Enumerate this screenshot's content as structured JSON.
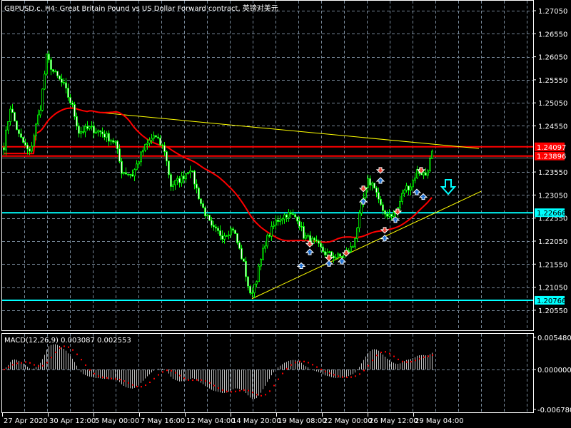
{
  "header": {
    "title": "GBPUSD.c, H4:  Great Britain Pound vs US Dollar Forward contract, 英镑对美元"
  },
  "macd": {
    "label": "MACD(12,26,9) 0.003087 0.002553",
    "axis": [
      "0.005480",
      "0.000000",
      "-0.006780"
    ],
    "max": 0.00548,
    "min": -0.00678
  },
  "price_axis": [
    "1.27050",
    "1.26550",
    "1.26050",
    "1.25550",
    "1.25050",
    "1.24550",
    "1.23550",
    "1.23050",
    "1.22550",
    "1.22050",
    "1.21550",
    "1.21050",
    "1.20550"
  ],
  "time_axis": [
    "27 Apr 2020",
    "30 Apr 12:00",
    "5 May 00:00",
    "7 May 16:00",
    "12 May 04:00",
    "14 May 20:00",
    "19 May 08:00",
    "22 May 00:00",
    "26 May 12:00",
    "29 May 04:00"
  ],
  "levels": [
    {
      "price": "1.24097",
      "color": "#ff0000"
    },
    {
      "price": "1.23896",
      "color": "#ff0000"
    },
    {
      "price": "1.22666",
      "color": "#00ffff"
    },
    {
      "price": "1.20766",
      "color": "#00ffff"
    }
  ],
  "colors": {
    "candle": "#00ff00",
    "ma": "#ff0000",
    "trend": "#ffff00",
    "grid": "#778899",
    "signal": "#ff0000",
    "hist": "#c0c0c0"
  },
  "chart_data": {
    "type": "candlestick",
    "symbol": "GBPUSD.c",
    "timeframe": "H4",
    "bars": 201,
    "close_anchors": [
      [
        0,
        1.2411
      ],
      [
        3,
        1.2496
      ],
      [
        7,
        1.2434
      ],
      [
        12,
        1.2395
      ],
      [
        17,
        1.2496
      ],
      [
        20,
        1.2604
      ],
      [
        23,
        1.2573
      ],
      [
        28,
        1.2542
      ],
      [
        32,
        1.2496
      ],
      [
        35,
        1.2442
      ],
      [
        40,
        1.245
      ],
      [
        45,
        1.2442
      ],
      [
        52,
        1.2419
      ],
      [
        55,
        1.2357
      ],
      [
        60,
        1.2349
      ],
      [
        65,
        1.2403
      ],
      [
        70,
        1.2434
      ],
      [
        75,
        1.2403
      ],
      [
        78,
        1.2326
      ],
      [
        83,
        1.2341
      ],
      [
        87,
        1.2364
      ],
      [
        92,
        1.2287
      ],
      [
        97,
        1.2233
      ],
      [
        102,
        1.2217
      ],
      [
        107,
        1.2233
      ],
      [
        112,
        1.2155
      ],
      [
        115,
        1.2086
      ],
      [
        118,
        1.2125
      ],
      [
        122,
        1.2202
      ],
      [
        127,
        1.2248
      ],
      [
        132,
        1.2264
      ],
      [
        137,
        1.2256
      ],
      [
        140,
        1.2217
      ],
      [
        145,
        1.2202
      ],
      [
        150,
        1.2179
      ],
      [
        155,
        1.2171
      ],
      [
        158,
        1.2171
      ],
      [
        163,
        1.2194
      ],
      [
        167,
        1.2279
      ],
      [
        170,
        1.2334
      ],
      [
        173,
        1.2326
      ],
      [
        177,
        1.2264
      ],
      [
        180,
        1.2264
      ],
      [
        183,
        1.2264
      ],
      [
        187,
        1.2318
      ],
      [
        190,
        1.2326
      ],
      [
        193,
        1.2357
      ],
      [
        197,
        1.2349
      ],
      [
        200,
        1.2395
      ]
    ],
    "ma_period": 40,
    "trendlines": [
      {
        "from": [
          45,
          1.2484
        ],
        "to": [
          222,
          1.2406
        ],
        "color": "#ffff00"
      },
      {
        "from": [
          116,
          1.208
        ],
        "to": [
          223,
          1.2313
        ],
        "color": "#ffff00"
      }
    ],
    "signals": [
      {
        "bar": 143,
        "price": 1.22,
        "dir": "down"
      },
      {
        "bar": 143,
        "price": 1.218,
        "dir": "up"
      },
      {
        "bar": 139,
        "price": 1.215,
        "dir": "up"
      },
      {
        "bar": 152,
        "price": 1.217,
        "dir": "down"
      },
      {
        "bar": 152,
        "price": 1.2155,
        "dir": "up"
      },
      {
        "bar": 160,
        "price": 1.218,
        "dir": "down"
      },
      {
        "bar": 158,
        "price": 1.216,
        "dir": "up"
      },
      {
        "bar": 168,
        "price": 1.232,
        "dir": "down"
      },
      {
        "bar": 168,
        "price": 1.229,
        "dir": "up"
      },
      {
        "bar": 176,
        "price": 1.236,
        "dir": "down"
      },
      {
        "bar": 176,
        "price": 1.2335,
        "dir": "up"
      },
      {
        "bar": 178,
        "price": 1.223,
        "dir": "down"
      },
      {
        "bar": 178,
        "price": 1.221,
        "dir": "up"
      },
      {
        "bar": 184,
        "price": 1.227,
        "dir": "down"
      },
      {
        "bar": 183,
        "price": 1.225,
        "dir": "up"
      },
      {
        "bar": 195,
        "price": 1.236,
        "dir": "down"
      },
      {
        "bar": 193,
        "price": 1.231,
        "dir": "up"
      },
      {
        "bar": 196,
        "price": 1.23,
        "dir": "up"
      }
    ]
  }
}
